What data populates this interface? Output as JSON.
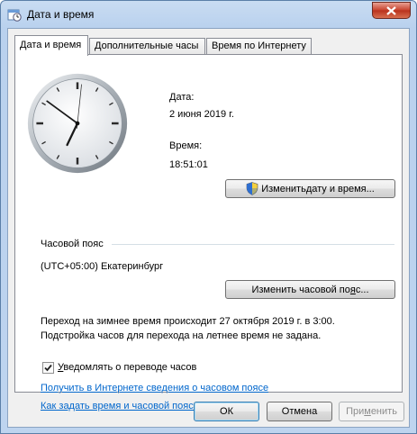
{
  "window": {
    "title": "Дата и время",
    "app_icon": "date-time-app-icon",
    "close_icon": "close-icon"
  },
  "tabs": [
    {
      "label": "Дата и время",
      "active": true
    },
    {
      "label": "Дополнительные часы",
      "active": false
    },
    {
      "label": "Время по Интернету",
      "active": false
    }
  ],
  "clock": {
    "hour": 18,
    "minute": 51,
    "second": 1,
    "icon": "analog-clock-icon"
  },
  "date_section": {
    "date_label": "Дата:",
    "date_value": "2 июня 2019 г.",
    "time_label": "Время:",
    "time_value": "18:51:01",
    "change_button_prefix": "Изменить ",
    "change_button_underlined": "д",
    "change_button_suffix": "ату и время...",
    "shield_icon": "uac-shield-icon"
  },
  "timezone": {
    "header": "Часовой пояс",
    "value": "(UTC+05:00) Екатеринбург",
    "change_button_prefix": "Изменить часовой по",
    "change_button_underlined": "я",
    "change_button_suffix": "с..."
  },
  "dst": {
    "line1": "Переход на зимнее время происходит 27 октября 2019 г. в 3:00.",
    "line2": "Подстройка часов для перехода на летнее время не задана."
  },
  "notify": {
    "checked": true,
    "label_underlined": "У",
    "label_rest": "ведомлять о переводе часов"
  },
  "links": {
    "timezone_info": "Получить в Интернете сведения о часовом поясе",
    "how_to": "Как задать время и часовой пояс?"
  },
  "buttons": {
    "ok": "ОК",
    "cancel": "Отмена",
    "apply_prefix": "При",
    "apply_underlined": "м",
    "apply_suffix": "енить"
  },
  "colors": {
    "link": "#0066cc",
    "close_button": "#c7402b",
    "accent_border": "#3c7fb1"
  }
}
